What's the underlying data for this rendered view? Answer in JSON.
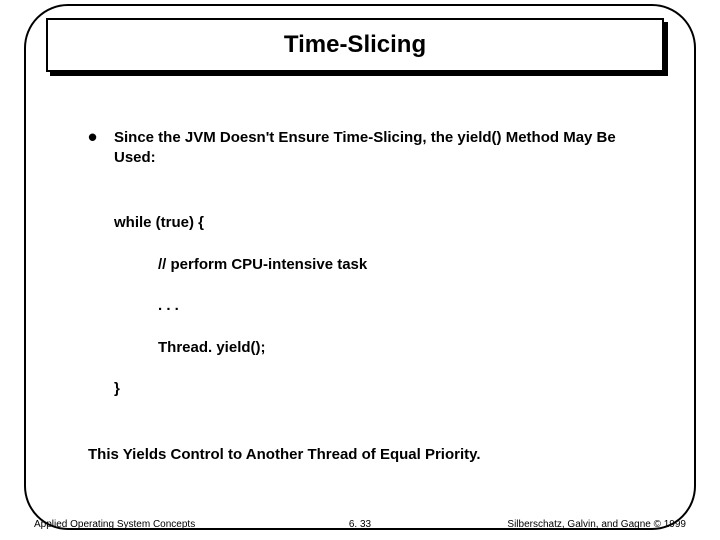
{
  "title": "Time-Slicing",
  "bullet": "Since the JVM Doesn't Ensure Time-Slicing, the yield() Method May Be Used:",
  "code": {
    "while": "while (true) {",
    "comment": "// perform CPU-intensive task",
    "ellipsis": ". . .",
    "yield": "Thread. yield();",
    "close": "}"
  },
  "summary": "This Yields Control to Another Thread of Equal Priority.",
  "footer": {
    "left": "Applied Operating System Concepts",
    "center": "6. 33",
    "right": "Silberschatz, Galvin, and Gagne © 1999"
  }
}
